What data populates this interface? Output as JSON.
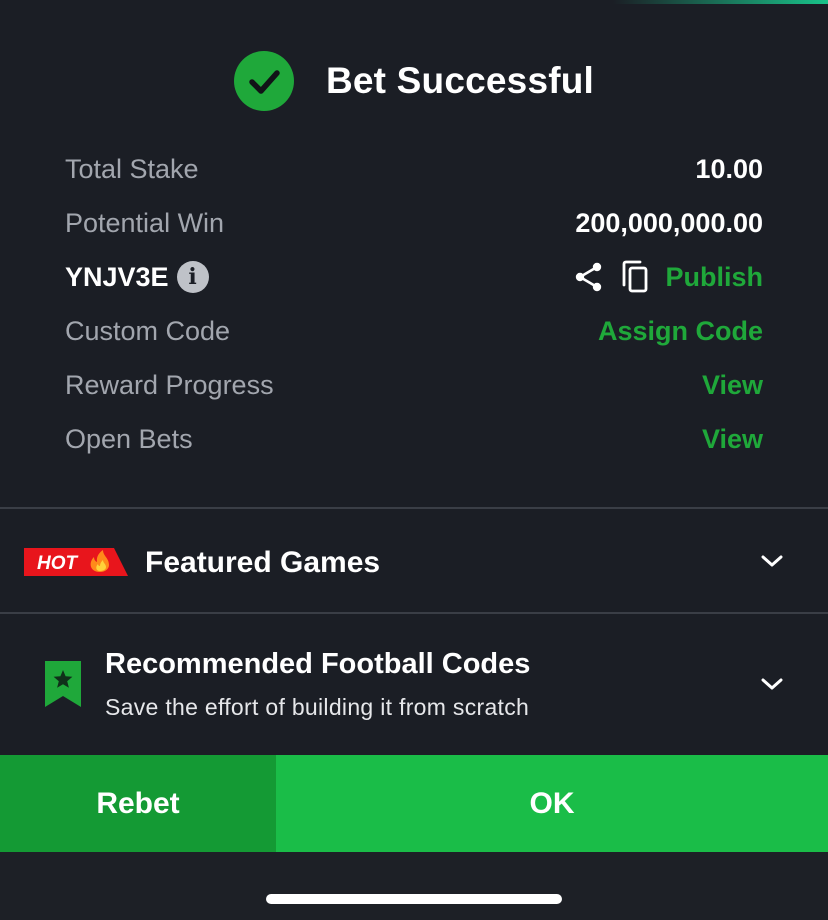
{
  "header": {
    "title": "Bet Successful"
  },
  "summary": {
    "total_stake_label": "Total Stake",
    "total_stake_value": "10.00",
    "potential_win_label": "Potential Win",
    "potential_win_value": "200,000,000.00",
    "booking_code": "YNJV3E",
    "publish_label": "Publish",
    "custom_code_label": "Custom Code",
    "assign_code_label": "Assign Code",
    "reward_progress_label": "Reward Progress",
    "reward_progress_link": "View",
    "open_bets_label": "Open Bets",
    "open_bets_link": "View"
  },
  "featured": {
    "badge": "HOT",
    "title": "Featured Games"
  },
  "recommended": {
    "title": "Recommended Football Codes",
    "subtitle": "Save the effort of building it from scratch"
  },
  "actions": {
    "rebet_label": "Rebet",
    "ok_label": "OK"
  },
  "icons": [
    "check-icon",
    "info-icon",
    "share-icon",
    "copy-icon",
    "fire-icon",
    "chevron-down-icon",
    "bookmark-star-icon"
  ],
  "colors": {
    "background": "#1b1e25",
    "accent_green": "#1fa83a",
    "ok_button": "#1abd48",
    "rebet_button": "#149a34",
    "hot_red": "#e8151c"
  }
}
